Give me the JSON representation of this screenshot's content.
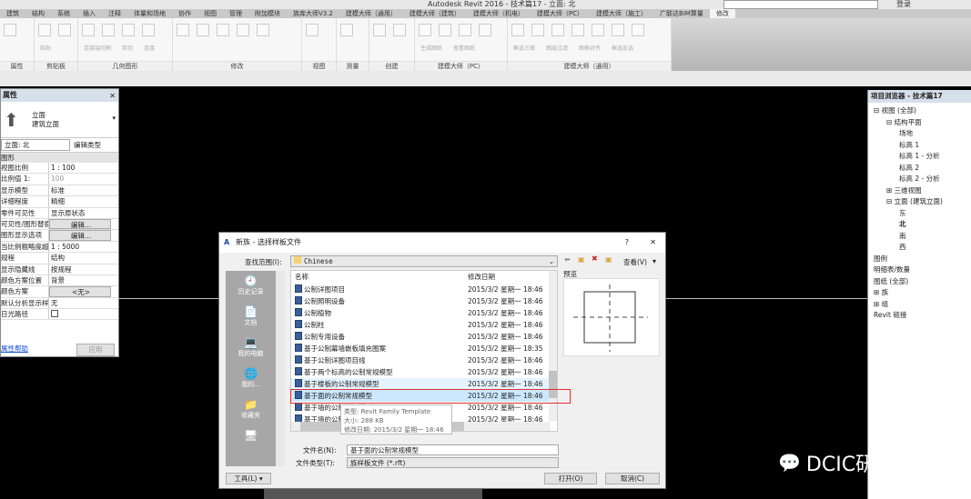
{
  "app": {
    "title": "Autodesk Revit 2016 -    技术篇17 - 立面: 北",
    "login": "登录"
  },
  "tabs": [
    "建筑",
    "结构",
    "系统",
    "插入",
    "注释",
    "体量和场地",
    "协作",
    "视图",
    "管理",
    "附加模块",
    "族库大师V3.2",
    "建模大师（通用）",
    "建模大师（建筑）",
    "建模大师（机电）",
    "建模大师（PC）",
    "建模大师（施工）",
    "广联达BIM算量",
    "修改"
  ],
  "active_tab": "修改",
  "ribbon_groups": [
    {
      "label": "属性",
      "w": 38,
      "caps": []
    },
    {
      "label": "剪贴板",
      "w": 48,
      "caps": [
        "粘贴"
      ]
    },
    {
      "label": "几何图形",
      "w": 104,
      "caps": [
        "连接端切割",
        "剪切",
        "连接"
      ]
    },
    {
      "label": "修改",
      "w": 142,
      "caps": []
    },
    {
      "label": "视图",
      "w": 38,
      "caps": []
    },
    {
      "label": "测量",
      "w": 36,
      "caps": []
    },
    {
      "label": "创建",
      "w": 50,
      "caps": []
    },
    {
      "label": "建模大师（PC）",
      "w": 102,
      "caps": [
        "生成图纸",
        "查看图纸"
      ]
    },
    {
      "label": "建模大师（通用）",
      "w": 180,
      "caps": [
        "框选三维",
        "图层过滤",
        "图框对齐",
        "框选反选"
      ]
    }
  ],
  "properties": {
    "title": "属性",
    "type_line1": "立面",
    "type_line2": "建筑立面",
    "selector": "立面: 北",
    "edit_type": "编辑类型",
    "section": "图形",
    "rows": [
      [
        "视图比例",
        "1 : 100"
      ],
      [
        "比例值 1:",
        "100"
      ],
      [
        "显示模型",
        "标准"
      ],
      [
        "详细程度",
        "精细"
      ],
      [
        "零件可见性",
        "显示原状态"
      ],
      [
        "可见性/图形替换",
        "编辑..."
      ],
      [
        "图形显示选项",
        "编辑..."
      ],
      [
        "当比例粗略度超...",
        "1 : 5000"
      ],
      [
        "规程",
        "结构"
      ],
      [
        "显示隐藏线",
        "按规程"
      ],
      [
        "颜色方案位置",
        "背景"
      ],
      [
        "颜色方案",
        "<无>"
      ],
      [
        "默认分析显示样...",
        "无"
      ],
      [
        "日光路径",
        ""
      ]
    ],
    "help": "属性帮助",
    "apply": "应用"
  },
  "browser": {
    "title": "项目浏览器 - 技术篇17",
    "nodes": [
      [
        "⊟ ",
        "视图 (全部)",
        0
      ],
      [
        "⊟ ",
        "结构平面",
        1
      ],
      [
        "",
        "场地",
        2
      ],
      [
        "",
        "标高 1",
        2
      ],
      [
        "",
        "标高 1 - 分析",
        2
      ],
      [
        "",
        "标高 2",
        2
      ],
      [
        "",
        "标高 2 - 分析",
        2
      ],
      [
        "⊞ ",
        "三维视图",
        1
      ],
      [
        "⊟ ",
        "立面 (建筑立面)",
        1
      ],
      [
        "",
        "东",
        2
      ],
      [
        "",
        "北",
        2
      ],
      [
        "",
        "南",
        2
      ],
      [
        "",
        "西",
        2
      ],
      [
        "",
        "图例",
        0
      ],
      [
        "",
        "明细表/数量",
        0
      ],
      [
        "",
        "图纸 (全部)",
        0
      ],
      [
        "⊞ ",
        "族",
        0
      ],
      [
        "⊞ ",
        "组",
        0
      ],
      [
        "",
        "Revit 链接",
        0
      ]
    ]
  },
  "dialog": {
    "title": "新族 - 选择样板文件",
    "help": "?",
    "close": "✕",
    "look_in_label": "查找范围(I):",
    "look_in": "Chinese",
    "view_menu": "查看(V)",
    "preview_label": "预览",
    "places": [
      "历史记录",
      "文档",
      "我的电脑",
      "我的...",
      "收藏夹",
      ""
    ],
    "col_name": "名称",
    "col_date": "修改日期",
    "files": [
      [
        "公制详图项目",
        "2015/3/2 星期一 18:46"
      ],
      [
        "公制照明设备",
        "2015/3/2 星期一 18:46"
      ],
      [
        "公制植物",
        "2015/3/2 星期一 18:46"
      ],
      [
        "公制柱",
        "2015/3/2 星期一 18:46"
      ],
      [
        "公制专用设备",
        "2015/3/2 星期一 18:46"
      ],
      [
        "基于公制幕墙嵌板填充图案",
        "2015/3/2 星期一 18:35"
      ],
      [
        "基于公制详图项目线",
        "2015/3/2 星期一 18:46"
      ],
      [
        "基于两个标高的公制常规模型",
        "2015/3/2 星期一 18:46"
      ],
      [
        "基于楼板的公制常规模型",
        "2015/3/2 星期一 18:46"
      ],
      [
        "基于面的公制常规模型",
        "2015/3/2 星期一 18:46"
      ],
      [
        "基于墙的公制常规模型",
        "2015/3/2 星期一 18:46"
      ],
      [
        "基于墙的公制...",
        "2015/3/2 星期一 18:46"
      ]
    ],
    "selected_index": 9,
    "tooltip": {
      "type": "类型: Revit Family Template",
      "size": "大小: 288 KB",
      "date": "修改日期: 2015/3/2 星期一 18:46"
    },
    "filename_label": "文件名(N):",
    "filename": "基于面的公制常规模型",
    "filetype_label": "文件类型(T):",
    "filetype": "族样板文件 (*.rft)",
    "tools": "工具(L)",
    "open": "打开(O)",
    "cancel": "取消(C)"
  },
  "watermark": "DCIC研究所",
  "colors": {
    "highlight": "#cce8ff",
    "red_box": "#e03030",
    "panel_header": "#d6e0ea"
  }
}
